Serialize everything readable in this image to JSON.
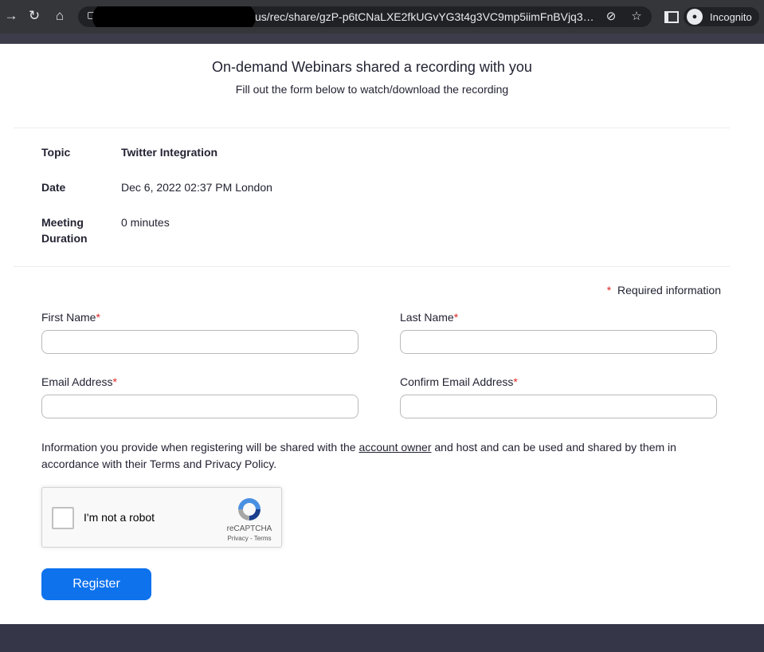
{
  "browser": {
    "url": "us/rec/share/gzP-p6tCNaLXE2fkUGvYG3t4g3VC9mp5iimFnBVjq3K4y...",
    "profile_label": "Incognito"
  },
  "page": {
    "title": "On-demand Webinars shared a recording with you",
    "subtitle": "Fill out the form below to watch/download the recording"
  },
  "details": {
    "topic_label": "Topic",
    "topic_value": "Twitter Integration",
    "date_label": "Date",
    "date_value": "Dec 6, 2022 02:37 PM London",
    "duration_label_line1": "Meeting",
    "duration_label_line2": "Duration",
    "duration_value": "0 minutes"
  },
  "form": {
    "required_star": "*",
    "required_note": "Required information",
    "first_name_label": "First Name",
    "last_name_label": "Last Name",
    "email_label": "Email Address",
    "confirm_email_label": "Confirm Email Address",
    "first_name_value": "",
    "last_name_value": "",
    "email_value": "",
    "confirm_email_value": "",
    "notice_before": "Information you provide when registering will be shared with the ",
    "notice_link": "account owner",
    "notice_after": " and host and can be used and shared by them in accordance with their Terms and Privacy Policy.",
    "register_label": "Register"
  },
  "captcha": {
    "label": "I'm not a robot",
    "brand": "reCAPTCHA",
    "terms": "Privacy - Terms"
  },
  "colors": {
    "primary": "#0e72ed",
    "required": "#e02828",
    "footer": "#363649"
  }
}
